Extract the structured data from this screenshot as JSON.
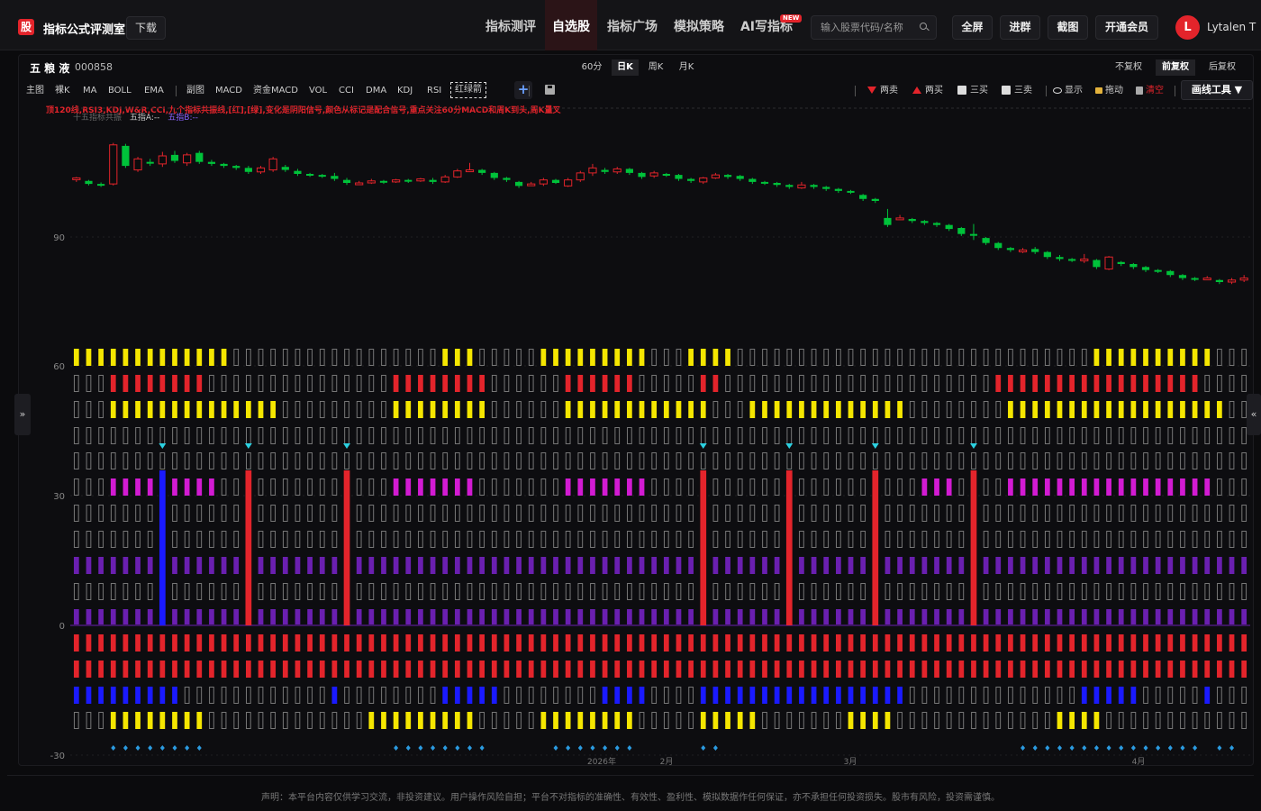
{
  "header": {
    "logo_badge": "股",
    "logo_text": "指标公式评测室",
    "download_label": "下载",
    "nav": [
      {
        "label": "指标测评",
        "active": false
      },
      {
        "label": "自选股",
        "active": true
      },
      {
        "label": "指标广场",
        "active": false
      },
      {
        "label": "模拟策略",
        "active": false
      },
      {
        "label": "AI写指标",
        "active": false
      }
    ],
    "new_badge": "NEW",
    "search_placeholder": "输入股票代码/名称",
    "buttons": [
      "全屏",
      "进群",
      "截图",
      "开通会员"
    ],
    "avatar_letter": "L",
    "username": "Lytalen T"
  },
  "stock": {
    "name": "五 粮 液",
    "code": "000858"
  },
  "periods": [
    {
      "label": "60分",
      "active": false
    },
    {
      "label": "日K",
      "active": true
    },
    {
      "label": "周K",
      "active": false
    },
    {
      "label": "月K",
      "active": false
    }
  ],
  "adjust": [
    {
      "label": "不复权",
      "active": false
    },
    {
      "label": "前复权",
      "active": true
    },
    {
      "label": "后复权",
      "active": false
    }
  ],
  "indicators_main": [
    "主图",
    "裸K",
    "MA",
    "BOLL",
    "EMA"
  ],
  "indicators_sub": [
    "副图",
    "MACD",
    "资金MACD",
    "VOL",
    "CCI",
    "DMA",
    "KDJ",
    "RSI"
  ],
  "indicator_boxed": "红绿箭",
  "draw_tools": {
    "two_sell": "两卖",
    "two_buy": "两买",
    "three_buy": "三买",
    "three_sell": "三卖",
    "show": "显示",
    "drag": "拖动",
    "clear": "清空",
    "tools": "画线工具 ▼"
  },
  "legend": {
    "line1": "顶120线,RSI3,KDJ,W&R,CCI,九个指标共振线,[红],[绿],变化是阴阳信号,颜色从标记是配合信号,重点关注60分MACD和周K到头,周K量叉",
    "line2_prefix": "十五指标共振",
    "line2_a": "五指A:--",
    "line2_b": "五指B:--"
  },
  "colors": {
    "up": "#e3242b",
    "down": "#00c23a",
    "yellow": "#f5e600",
    "magenta": "#d21bd2",
    "purple": "#6a1fb0",
    "blue": "#1a1aff",
    "cyan": "#2bd0e0",
    "gray_outline": "#777777"
  },
  "chart_data": {
    "type": "candlestick+indicator",
    "y_ticks": [
      "90",
      "60",
      "30",
      "0",
      "-30"
    ],
    "x_labels": [
      "2026年",
      "2月",
      "3月",
      "4月"
    ],
    "candles": [
      [
        101.5,
        101.8,
        101.0,
        102.0
      ],
      [
        101.2,
        100.6,
        100.3,
        101.4
      ],
      [
        100.6,
        100.3,
        100.0,
        100.9
      ],
      [
        100.6,
        108.4,
        100.3,
        108.8
      ],
      [
        108.2,
        104.2,
        103.8,
        108.6
      ],
      [
        103.4,
        105.6,
        103.0,
        106.0
      ],
      [
        105.0,
        104.8,
        104.2,
        105.6
      ],
      [
        104.6,
        106.2,
        104.0,
        107.0
      ],
      [
        106.4,
        105.2,
        104.8,
        107.2
      ],
      [
        104.8,
        106.4,
        104.2,
        106.8
      ],
      [
        106.8,
        105.0,
        104.6,
        107.2
      ],
      [
        105.0,
        104.6,
        104.2,
        105.4
      ],
      [
        104.6,
        104.2,
        103.8,
        104.8
      ],
      [
        104.2,
        103.8,
        103.4,
        104.4
      ],
      [
        103.8,
        103.0,
        102.6,
        104.2
      ],
      [
        103.0,
        103.8,
        102.6,
        104.2
      ],
      [
        103.4,
        105.6,
        103.0,
        106.0
      ],
      [
        104.0,
        103.4,
        103.0,
        104.4
      ],
      [
        103.2,
        102.6,
        102.2,
        103.6
      ],
      [
        102.6,
        102.4,
        102.0,
        102.8
      ],
      [
        102.4,
        102.2,
        101.8,
        102.6
      ],
      [
        102.2,
        101.6,
        101.2,
        102.8
      ],
      [
        101.4,
        100.8,
        100.4,
        101.8
      ],
      [
        100.8,
        100.8,
        100.4,
        101.2
      ],
      [
        100.8,
        101.2,
        100.6,
        101.6
      ],
      [
        101.2,
        101.0,
        100.6,
        101.4
      ],
      [
        101.0,
        101.4,
        100.8,
        101.6
      ],
      [
        101.4,
        101.2,
        100.8,
        101.6
      ],
      [
        101.2,
        101.6,
        101.0,
        101.8
      ],
      [
        101.4,
        101.0,
        100.6,
        101.8
      ],
      [
        101.0,
        102.0,
        100.8,
        102.4
      ],
      [
        102.0,
        103.2,
        101.8,
        103.6
      ],
      [
        103.2,
        103.4,
        103.0,
        104.8
      ],
      [
        103.4,
        102.8,
        102.4,
        103.6
      ],
      [
        102.8,
        101.8,
        101.4,
        103.0
      ],
      [
        101.8,
        101.4,
        101.0,
        102.0
      ],
      [
        101.0,
        100.2,
        99.8,
        101.2
      ],
      [
        100.4,
        100.6,
        100.2,
        101.0
      ],
      [
        100.6,
        101.4,
        100.2,
        101.8
      ],
      [
        101.4,
        100.8,
        100.6,
        101.6
      ],
      [
        100.2,
        101.4,
        100.0,
        101.8
      ],
      [
        101.4,
        102.8,
        101.0,
        103.2
      ],
      [
        102.8,
        103.8,
        102.2,
        104.6
      ],
      [
        103.4,
        103.0,
        102.6,
        103.8
      ],
      [
        103.0,
        103.6,
        102.6,
        104.0
      ],
      [
        103.6,
        102.8,
        102.4,
        103.8
      ],
      [
        102.8,
        102.0,
        101.6,
        103.0
      ],
      [
        102.2,
        102.8,
        101.8,
        103.2
      ],
      [
        102.6,
        102.4,
        102.0,
        102.8
      ],
      [
        102.4,
        101.6,
        101.2,
        102.6
      ],
      [
        101.6,
        101.2,
        100.8,
        101.8
      ],
      [
        101.0,
        101.8,
        100.6,
        102.0
      ],
      [
        101.8,
        102.4,
        101.6,
        102.8
      ],
      [
        102.4,
        102.0,
        101.6,
        102.6
      ],
      [
        102.2,
        101.6,
        101.2,
        102.4
      ],
      [
        101.6,
        101.0,
        100.6,
        101.8
      ],
      [
        101.0,
        100.8,
        100.4,
        101.2
      ],
      [
        100.8,
        100.4,
        100.0,
        101.0
      ],
      [
        100.4,
        100.0,
        99.6,
        100.6
      ],
      [
        99.8,
        100.4,
        99.6,
        101.0
      ],
      [
        100.4,
        100.0,
        99.6,
        100.6
      ],
      [
        100.0,
        99.6,
        99.2,
        100.2
      ],
      [
        99.6,
        99.2,
        98.8,
        99.8
      ],
      [
        99.2,
        99.0,
        98.6,
        99.4
      ],
      [
        98.4,
        97.6,
        97.2,
        98.6
      ],
      [
        97.6,
        97.2,
        96.8,
        97.8
      ],
      [
        93.8,
        92.4,
        92.0,
        95.6
      ],
      [
        93.6,
        93.8,
        93.4,
        94.4
      ],
      [
        93.6,
        93.2,
        92.8,
        93.8
      ],
      [
        93.2,
        92.8,
        92.4,
        93.4
      ],
      [
        92.8,
        92.4,
        92.0,
        93.0
      ],
      [
        92.4,
        91.6,
        91.2,
        92.6
      ],
      [
        91.8,
        90.6,
        90.2,
        92.0
      ],
      [
        90.6,
        90.4,
        89.4,
        92.6
      ],
      [
        89.8,
        88.8,
        88.4,
        90.0
      ],
      [
        88.8,
        87.8,
        87.4,
        89.0
      ],
      [
        87.8,
        87.4,
        87.0,
        88.0
      ],
      [
        87.2,
        87.4,
        86.8,
        87.8
      ],
      [
        87.6,
        87.0,
        86.6,
        88.0
      ],
      [
        87.0,
        86.0,
        85.6,
        87.2
      ],
      [
        86.0,
        85.6,
        85.2,
        86.4
      ],
      [
        85.6,
        85.4,
        85.0,
        85.8
      ],
      [
        85.4,
        85.6,
        84.8,
        86.6
      ],
      [
        85.4,
        84.0,
        83.6,
        85.6
      ],
      [
        83.6,
        86.0,
        83.4,
        86.2
      ],
      [
        85.0,
        84.6,
        84.2,
        85.2
      ],
      [
        84.6,
        84.0,
        83.6,
        84.8
      ],
      [
        84.0,
        83.4,
        83.0,
        84.2
      ],
      [
        83.4,
        83.2,
        82.8,
        83.6
      ],
      [
        83.2,
        82.4,
        82.0,
        83.4
      ],
      [
        82.4,
        81.8,
        81.4,
        82.6
      ],
      [
        81.8,
        81.6,
        81.2,
        82.0
      ],
      [
        81.6,
        81.8,
        81.4,
        82.2
      ],
      [
        81.4,
        81.0,
        80.6,
        81.6
      ],
      [
        81.0,
        81.4,
        80.6,
        81.8
      ],
      [
        81.4,
        81.8,
        81.0,
        82.4
      ]
    ],
    "signal_arrows": [
      7,
      14,
      22,
      51,
      58,
      65,
      73
    ]
  },
  "disclaimer": "声明：本平台内容仅供学习交流，非投资建议。用户操作风险自担；平台不对指标的准确性、有效性、盈利性、模拟数据作任何保证，亦不承担任何投资损失。股市有风险，投资需谨慎。"
}
